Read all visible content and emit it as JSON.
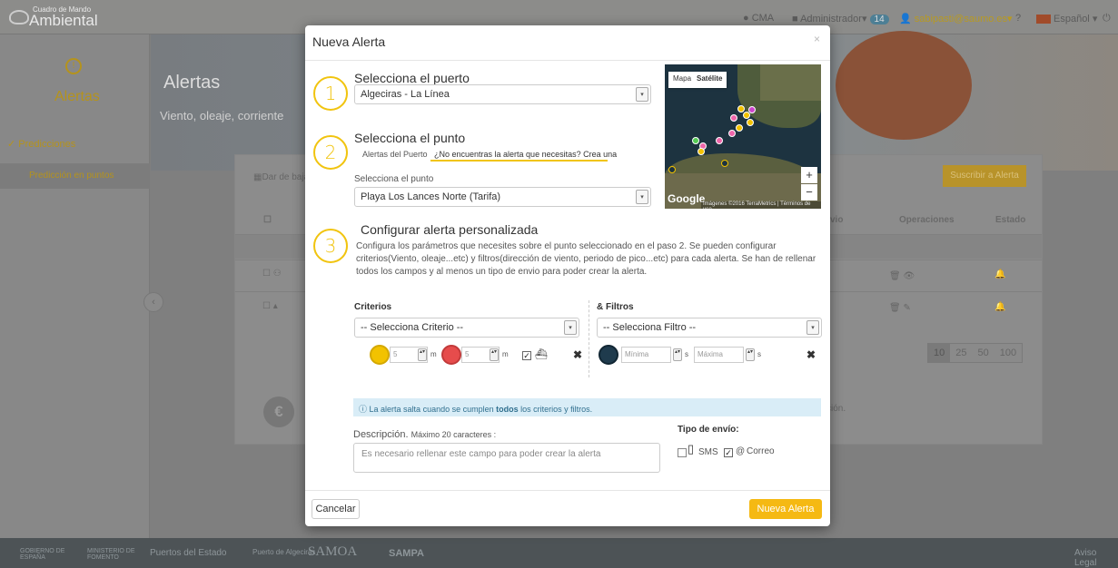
{
  "app": {
    "logo_line1": "Cuadro de Mando",
    "logo_line2": "Ambiental"
  },
  "topbar": {
    "cma": "CMA",
    "admin": "Administrador",
    "admin_badge": "14",
    "user_email": "sabipasti@saumo.es",
    "help": "?",
    "language": "Español",
    "power_icon": "power-icon"
  },
  "sidebar": {
    "section_title": "Alertas",
    "group": "Predicciones",
    "item": "Predicción en puntos"
  },
  "hero": {
    "title": "Alertas",
    "subtitle": "Viento, oleaje, corriente"
  },
  "background_table": {
    "subscribe_button": "Suscribir a Alerta",
    "filter_label": "Dar de baja",
    "col_operations": "Operaciones",
    "col_state": "Estado",
    "col_envio": "vio",
    "page_sizes": [
      "10",
      "25",
      "50",
      "100"
    ],
    "page_size_selected": "10",
    "info_text": "ción."
  },
  "footer": {
    "org1": "GOBIERNO DE ESPAÑA",
    "org2": "MINISTERIO DE FOMENTO",
    "org3": "Puertos del Estado",
    "org4": "Puerto de Algeciras",
    "org5": "SAMOA",
    "org6": "SAMPA",
    "legal": "Aviso Legal"
  },
  "modal": {
    "title": "Nueva Alerta",
    "close": "×",
    "step1": {
      "number": "1",
      "heading": "Selecciona el puerto",
      "selected_port": "Algeciras - La Línea"
    },
    "step2": {
      "number": "2",
      "heading": "Selecciona el punto",
      "tab1": "Alertas del Puerto",
      "tab2": "¿No encuentras la alerta que necesitas? Crea una",
      "select_label": "Selecciona el punto",
      "selected_point": "Playa Los Lances Norte (Tarifa)"
    },
    "map": {
      "btn_map": "Mapa",
      "btn_satellite": "Satélite",
      "zoom_in": "+",
      "zoom_out": "−",
      "google": "Google",
      "attribution": "Imágenes ©2016 TerraMetrics | Términos de uso"
    },
    "step3": {
      "number": "3",
      "heading": "Configurar alerta personalizada",
      "description": "Configura los parámetros que necesites sobre el punto seleccionado en el paso 2. Se pueden configurar criterios(Viento, oleaje...etc) y filtros(dirección de viento, periodo de pico...etc) para cada alerta. Se han de rellenar todos los campos y al menos un tipo de envio para poder crear la alerta."
    },
    "criteria": {
      "heading": "Criterios",
      "select": "-- Selecciona Criterio --",
      "value1_placeholder": "5",
      "unit1": "m",
      "value2_placeholder": "5",
      "unit2": "m",
      "checked": "☑"
    },
    "filters": {
      "heading": "& Filtros",
      "select": "-- Selecciona Filtro --",
      "min_placeholder": "Mínima",
      "unit_min": "s",
      "max_placeholder": "Máxima",
      "unit_max": "s"
    },
    "info": {
      "prefix": "La alerta salta cuando se cumplen ",
      "bold": "todos",
      "suffix": " los criterios y filtros."
    },
    "description": {
      "label": "Descripción.",
      "hint": "Máximo 20 caracteres :",
      "placeholder": "Es necesario rellenar este campo para poder crear la alerta"
    },
    "send_type": {
      "label": "Tipo de envío:",
      "sms": "SMS",
      "email": "Correo"
    },
    "cancel": "Cancelar",
    "submit": "Nueva Alerta"
  },
  "colors": {
    "accent": "#f1c40f",
    "submit": "#f5b913",
    "info_bg": "#d9edf7",
    "wave_yellow": "#f2c200",
    "wave_red": "#e64c4c",
    "filter_navy": "#1f3b4d"
  }
}
